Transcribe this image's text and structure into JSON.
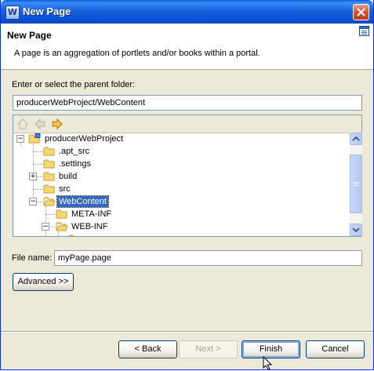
{
  "window": {
    "title": "New Page",
    "app_icon_letter": "W"
  },
  "header": {
    "title": "New Page",
    "description": "A page is an aggregation of portlets and/or books within a portal."
  },
  "parent_folder": {
    "label": "Enter or select the parent folder:",
    "value": "producerWebProject/WebContent"
  },
  "tree": {
    "toolbar": [
      "home-icon",
      "back-arrow-icon",
      "forward-arrow-icon"
    ],
    "items": [
      {
        "label": "producerWebProject",
        "expander": "−"
      },
      {
        "label": ".apt_src",
        "expander": ""
      },
      {
        "label": ".settings",
        "expander": ""
      },
      {
        "label": "build",
        "expander": "+"
      },
      {
        "label": "src",
        "expander": ""
      },
      {
        "label": "WebContent",
        "expander": "−",
        "selected": true
      },
      {
        "label": "META-INF",
        "expander": ""
      },
      {
        "label": "WEB-INF",
        "expander": "−"
      }
    ]
  },
  "file_name": {
    "label": "File name:",
    "value": "myPage.page"
  },
  "buttons": {
    "advanced": "Advanced >>",
    "back": "< Back",
    "next": "Next >",
    "finish": "Finish",
    "cancel": "Cancel"
  }
}
